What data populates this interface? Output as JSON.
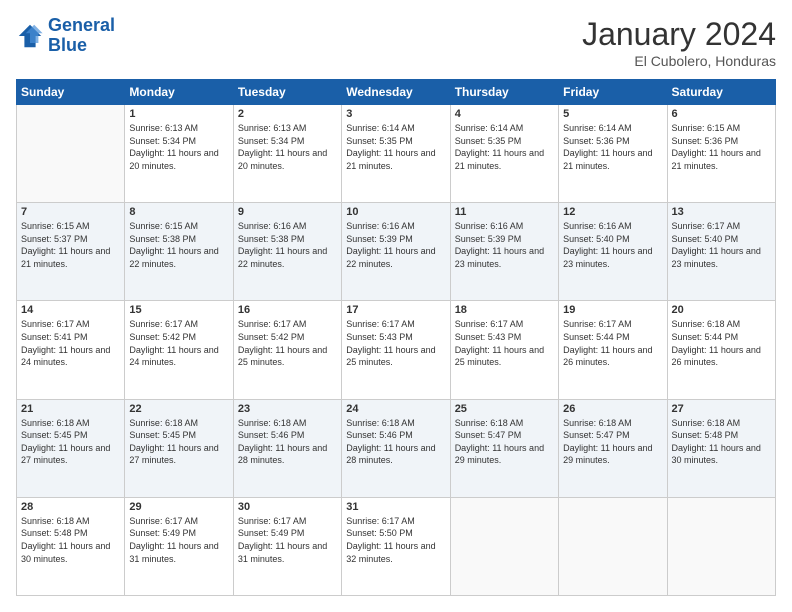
{
  "header": {
    "logo_general": "General",
    "logo_blue": "Blue",
    "month_title": "January 2024",
    "location": "El Cubolero, Honduras"
  },
  "weekdays": [
    "Sunday",
    "Monday",
    "Tuesday",
    "Wednesday",
    "Thursday",
    "Friday",
    "Saturday"
  ],
  "weeks": [
    [
      {
        "day": "",
        "sunrise": "",
        "sunset": "",
        "daylight": ""
      },
      {
        "day": "1",
        "sunrise": "Sunrise: 6:13 AM",
        "sunset": "Sunset: 5:34 PM",
        "daylight": "Daylight: 11 hours and 20 minutes."
      },
      {
        "day": "2",
        "sunrise": "Sunrise: 6:13 AM",
        "sunset": "Sunset: 5:34 PM",
        "daylight": "Daylight: 11 hours and 20 minutes."
      },
      {
        "day": "3",
        "sunrise": "Sunrise: 6:14 AM",
        "sunset": "Sunset: 5:35 PM",
        "daylight": "Daylight: 11 hours and 21 minutes."
      },
      {
        "day": "4",
        "sunrise": "Sunrise: 6:14 AM",
        "sunset": "Sunset: 5:35 PM",
        "daylight": "Daylight: 11 hours and 21 minutes."
      },
      {
        "day": "5",
        "sunrise": "Sunrise: 6:14 AM",
        "sunset": "Sunset: 5:36 PM",
        "daylight": "Daylight: 11 hours and 21 minutes."
      },
      {
        "day": "6",
        "sunrise": "Sunrise: 6:15 AM",
        "sunset": "Sunset: 5:36 PM",
        "daylight": "Daylight: 11 hours and 21 minutes."
      }
    ],
    [
      {
        "day": "7",
        "sunrise": "Sunrise: 6:15 AM",
        "sunset": "Sunset: 5:37 PM",
        "daylight": "Daylight: 11 hours and 21 minutes."
      },
      {
        "day": "8",
        "sunrise": "Sunrise: 6:15 AM",
        "sunset": "Sunset: 5:38 PM",
        "daylight": "Daylight: 11 hours and 22 minutes."
      },
      {
        "day": "9",
        "sunrise": "Sunrise: 6:16 AM",
        "sunset": "Sunset: 5:38 PM",
        "daylight": "Daylight: 11 hours and 22 minutes."
      },
      {
        "day": "10",
        "sunrise": "Sunrise: 6:16 AM",
        "sunset": "Sunset: 5:39 PM",
        "daylight": "Daylight: 11 hours and 22 minutes."
      },
      {
        "day": "11",
        "sunrise": "Sunrise: 6:16 AM",
        "sunset": "Sunset: 5:39 PM",
        "daylight": "Daylight: 11 hours and 23 minutes."
      },
      {
        "day": "12",
        "sunrise": "Sunrise: 6:16 AM",
        "sunset": "Sunset: 5:40 PM",
        "daylight": "Daylight: 11 hours and 23 minutes."
      },
      {
        "day": "13",
        "sunrise": "Sunrise: 6:17 AM",
        "sunset": "Sunset: 5:40 PM",
        "daylight": "Daylight: 11 hours and 23 minutes."
      }
    ],
    [
      {
        "day": "14",
        "sunrise": "Sunrise: 6:17 AM",
        "sunset": "Sunset: 5:41 PM",
        "daylight": "Daylight: 11 hours and 24 minutes."
      },
      {
        "day": "15",
        "sunrise": "Sunrise: 6:17 AM",
        "sunset": "Sunset: 5:42 PM",
        "daylight": "Daylight: 11 hours and 24 minutes."
      },
      {
        "day": "16",
        "sunrise": "Sunrise: 6:17 AM",
        "sunset": "Sunset: 5:42 PM",
        "daylight": "Daylight: 11 hours and 25 minutes."
      },
      {
        "day": "17",
        "sunrise": "Sunrise: 6:17 AM",
        "sunset": "Sunset: 5:43 PM",
        "daylight": "Daylight: 11 hours and 25 minutes."
      },
      {
        "day": "18",
        "sunrise": "Sunrise: 6:17 AM",
        "sunset": "Sunset: 5:43 PM",
        "daylight": "Daylight: 11 hours and 25 minutes."
      },
      {
        "day": "19",
        "sunrise": "Sunrise: 6:17 AM",
        "sunset": "Sunset: 5:44 PM",
        "daylight": "Daylight: 11 hours and 26 minutes."
      },
      {
        "day": "20",
        "sunrise": "Sunrise: 6:18 AM",
        "sunset": "Sunset: 5:44 PM",
        "daylight": "Daylight: 11 hours and 26 minutes."
      }
    ],
    [
      {
        "day": "21",
        "sunrise": "Sunrise: 6:18 AM",
        "sunset": "Sunset: 5:45 PM",
        "daylight": "Daylight: 11 hours and 27 minutes."
      },
      {
        "day": "22",
        "sunrise": "Sunrise: 6:18 AM",
        "sunset": "Sunset: 5:45 PM",
        "daylight": "Daylight: 11 hours and 27 minutes."
      },
      {
        "day": "23",
        "sunrise": "Sunrise: 6:18 AM",
        "sunset": "Sunset: 5:46 PM",
        "daylight": "Daylight: 11 hours and 28 minutes."
      },
      {
        "day": "24",
        "sunrise": "Sunrise: 6:18 AM",
        "sunset": "Sunset: 5:46 PM",
        "daylight": "Daylight: 11 hours and 28 minutes."
      },
      {
        "day": "25",
        "sunrise": "Sunrise: 6:18 AM",
        "sunset": "Sunset: 5:47 PM",
        "daylight": "Daylight: 11 hours and 29 minutes."
      },
      {
        "day": "26",
        "sunrise": "Sunrise: 6:18 AM",
        "sunset": "Sunset: 5:47 PM",
        "daylight": "Daylight: 11 hours and 29 minutes."
      },
      {
        "day": "27",
        "sunrise": "Sunrise: 6:18 AM",
        "sunset": "Sunset: 5:48 PM",
        "daylight": "Daylight: 11 hours and 30 minutes."
      }
    ],
    [
      {
        "day": "28",
        "sunrise": "Sunrise: 6:18 AM",
        "sunset": "Sunset: 5:48 PM",
        "daylight": "Daylight: 11 hours and 30 minutes."
      },
      {
        "day": "29",
        "sunrise": "Sunrise: 6:17 AM",
        "sunset": "Sunset: 5:49 PM",
        "daylight": "Daylight: 11 hours and 31 minutes."
      },
      {
        "day": "30",
        "sunrise": "Sunrise: 6:17 AM",
        "sunset": "Sunset: 5:49 PM",
        "daylight": "Daylight: 11 hours and 31 minutes."
      },
      {
        "day": "31",
        "sunrise": "Sunrise: 6:17 AM",
        "sunset": "Sunset: 5:50 PM",
        "daylight": "Daylight: 11 hours and 32 minutes."
      },
      {
        "day": "",
        "sunrise": "",
        "sunset": "",
        "daylight": ""
      },
      {
        "day": "",
        "sunrise": "",
        "sunset": "",
        "daylight": ""
      },
      {
        "day": "",
        "sunrise": "",
        "sunset": "",
        "daylight": ""
      }
    ]
  ]
}
